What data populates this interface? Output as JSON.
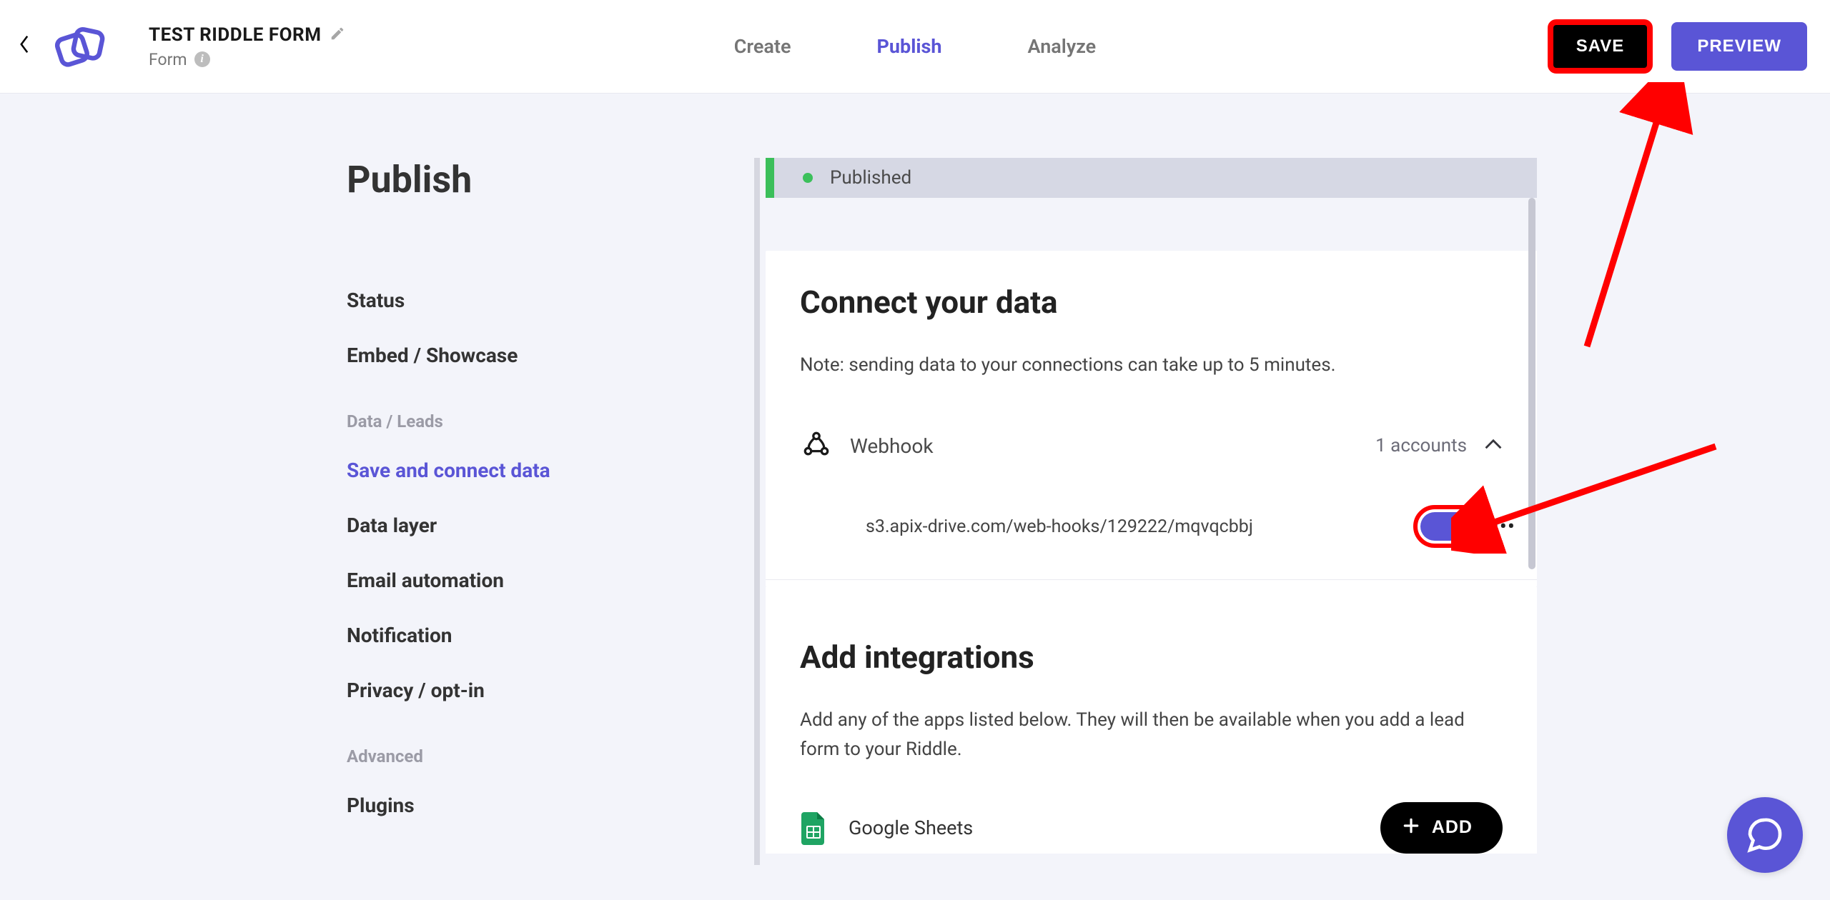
{
  "header": {
    "form_title": "TEST RIDDLE FORM",
    "form_subtitle": "Form",
    "tabs": {
      "create": "Create",
      "publish": "Publish",
      "analyze": "Analyze"
    },
    "save_label": "SAVE",
    "preview_label": "PREVIEW"
  },
  "sidebar": {
    "heading": "Publish",
    "items": [
      {
        "label": "Status"
      },
      {
        "label": "Embed / Showcase"
      }
    ],
    "group1_label": "Data / Leads",
    "group1_items": [
      {
        "label": "Save and connect data",
        "active": true
      },
      {
        "label": "Data layer"
      },
      {
        "label": "Email automation"
      },
      {
        "label": "Notification"
      },
      {
        "label": "Privacy / opt-in"
      }
    ],
    "group2_label": "Advanced",
    "group2_items": [
      {
        "label": "Plugins"
      }
    ]
  },
  "content": {
    "status_text": "Published",
    "connect_heading": "Connect your data",
    "connect_note": "Note: sending data to your connections can take up to 5 minutes.",
    "webhook_label": "Webhook",
    "webhook_accounts": "1 accounts",
    "webhook_item_url": "s3.apix-drive.com/web-hooks/129222/mqvqcbbj",
    "integrations_heading": "Add integrations",
    "integrations_note": "Add any of the apps listed below. They will then be available when you add a lead form to your Riddle.",
    "integration1_name": "Google Sheets",
    "add_label": "ADD"
  }
}
